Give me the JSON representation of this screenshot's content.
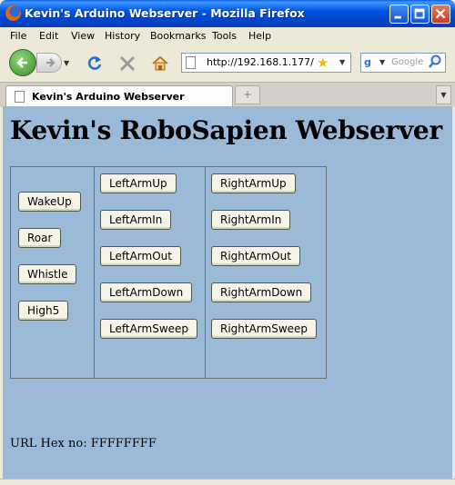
{
  "window": {
    "title": "Kevin's Arduino Webserver - Mozilla Firefox",
    "buttons": [
      "minimize",
      "maximize",
      "close"
    ]
  },
  "menubar": {
    "items": [
      "File",
      "Edit",
      "View",
      "History",
      "Bookmarks",
      "Tools",
      "Help"
    ]
  },
  "navigation": {
    "url": "http://192.168.1.177/",
    "search_placeholder": "Google",
    "icons": [
      "back-arrow-icon",
      "forward-arrow-icon",
      "reload-icon",
      "stop-icon",
      "home-icon",
      "page-icon",
      "star-icon",
      "google-icon",
      "magnifier-icon"
    ]
  },
  "tabs": {
    "active_title": "Kevin's Arduino Webserver",
    "new_tab_glyph": "+"
  },
  "page": {
    "heading": "Kevin's RoboSapien Webserver",
    "general_commands": [
      "WakeUp",
      "Roar",
      "Whistle",
      "High5"
    ],
    "left_arm_commands": [
      "LeftArmUp",
      "LeftArmIn",
      "LeftArmOut",
      "LeftArmDown",
      "LeftArmSweep"
    ],
    "right_arm_commands": [
      "RightArmUp",
      "RightArmIn",
      "RightArmOut",
      "RightArmDown",
      "RightArmSweep"
    ],
    "url_hex_line": "URL Hex no: FFFFFFFF"
  },
  "colors": {
    "titlebar_blue": "#0055e5",
    "content_background": "#9bbad8",
    "chrome_background": "#ece9d8",
    "close_button_red": "#c3401f"
  }
}
